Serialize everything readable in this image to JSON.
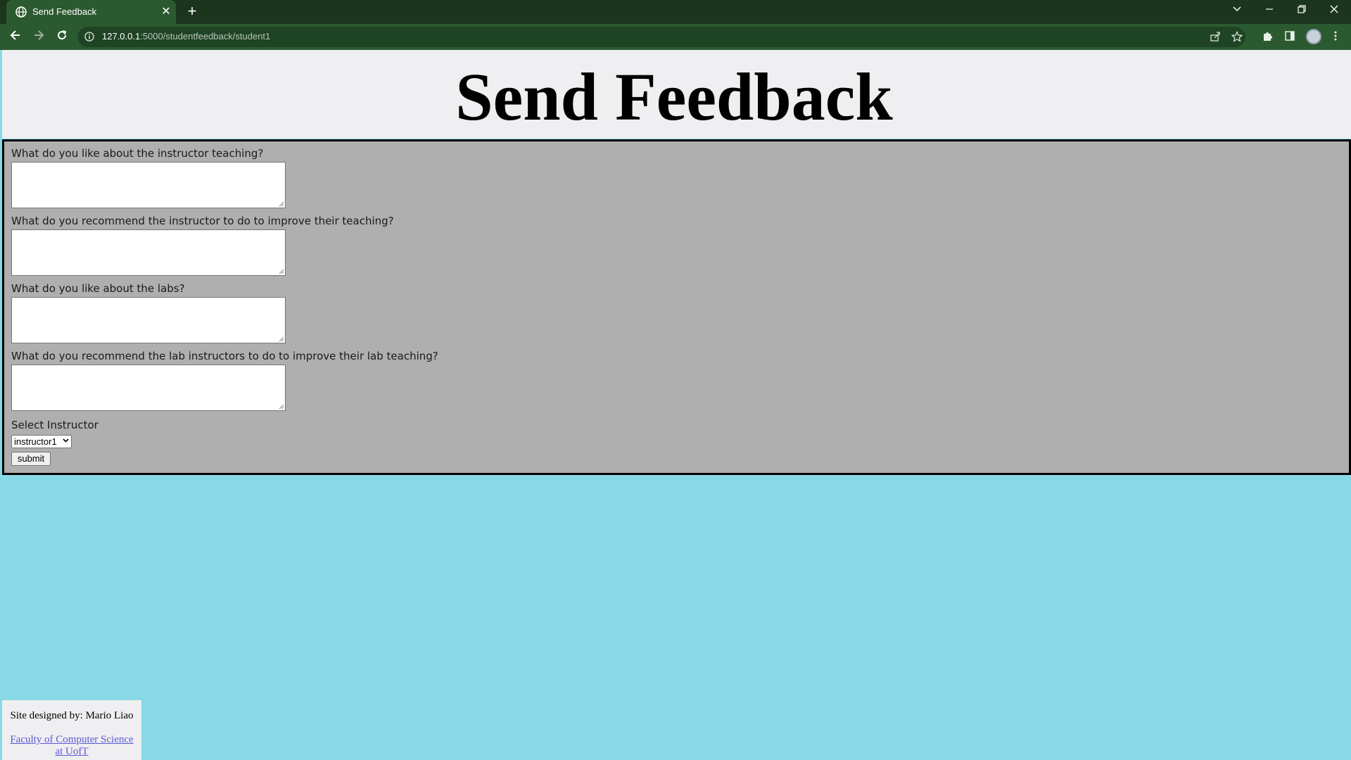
{
  "browser": {
    "tab_title": "Send Feedback",
    "tab_close": "✕",
    "new_tab": "+",
    "url_host": "127.0.0.1",
    "url_path": ":5000/studentfeedback/student1"
  },
  "page": {
    "title": "Send Feedback"
  },
  "form": {
    "questions": [
      {
        "label": "What do you like about the instructor teaching?",
        "value": ""
      },
      {
        "label": "What do you recommend the instructor to do to improve their teaching?",
        "value": ""
      },
      {
        "label": "What do you like about the labs?",
        "value": ""
      },
      {
        "label": "What do you recommend the lab instructors to do to improve their lab teaching?",
        "value": ""
      }
    ],
    "select_label": "Select Instructor",
    "selected_instructor": "instructor1",
    "submit_label": "submit"
  },
  "footer": {
    "credit": "Site designed by: Mario Liao",
    "link_line1": "Faculty of Computer Science",
    "link_line2": "at UofT"
  }
}
